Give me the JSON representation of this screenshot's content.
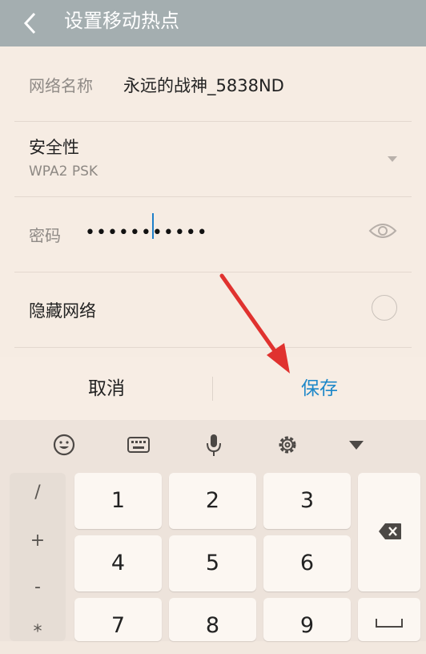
{
  "header": {
    "title": "设置移动热点"
  },
  "form": {
    "ssid_label": "网络名称",
    "ssid_value": "永远的战神_5838ND",
    "security_label": "安全性",
    "security_value": "WPA2 PSK",
    "password_label": "密码",
    "password_mask": "•••••••••••",
    "hidden_label": "隐藏网络"
  },
  "buttons": {
    "cancel": "取消",
    "save": "保存"
  },
  "keyboard": {
    "tools": [
      "emoji-icon",
      "keyboard-icon",
      "microphone-icon",
      "settings-icon",
      "collapse-icon"
    ],
    "symbols": [
      "/",
      "+",
      "-",
      "*"
    ],
    "digits": [
      "1",
      "2",
      "3",
      "4",
      "5",
      "6",
      "7",
      "8",
      "9"
    ]
  },
  "colors": {
    "accent": "#1e88c9",
    "arrow": "#e0322f"
  }
}
